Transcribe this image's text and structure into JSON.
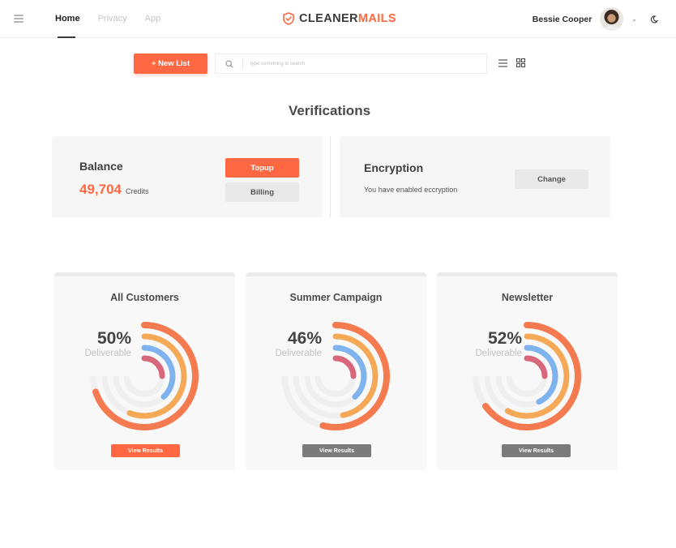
{
  "nav": {
    "items": [
      "Home",
      "Privacy",
      "App"
    ],
    "active": 0
  },
  "brand": {
    "part1": "CLEANER",
    "part2": "MAILS"
  },
  "user": {
    "name": "Bessie Cooper"
  },
  "toolbar": {
    "new_list": "+ New List",
    "search_placeholder": "type something to search"
  },
  "page": {
    "title": "Verifications"
  },
  "balance": {
    "title": "Balance",
    "amount": "49,704",
    "unit": "Credits",
    "topup": "Topup",
    "billing": "Billing"
  },
  "encryption": {
    "title": "Encryption",
    "description": "You have enabled eccryption",
    "change": "Change"
  },
  "cards": [
    {
      "title": "All Customers",
      "percent": "50%",
      "label": "Deliverable",
      "button": "View Results",
      "primary": true,
      "rings": [
        0.7,
        0.56,
        0.38,
        0.25
      ]
    },
    {
      "title": "Summer Campaign",
      "percent": "46%",
      "label": "Deliverable",
      "button": "View Results",
      "primary": false,
      "rings": [
        0.54,
        0.47,
        0.38,
        0.25
      ]
    },
    {
      "title": "Newsletter",
      "percent": "52%",
      "label": "Deliverable",
      "button": "View Results",
      "primary": false,
      "rings": [
        0.65,
        0.58,
        0.43,
        0.25
      ]
    }
  ],
  "colors": {
    "accent": "#ff6842",
    "ring_orange": "#f57a50",
    "ring_amber": "#f5a855",
    "ring_blue": "#7fb3ef",
    "ring_rose": "#d9677c",
    "track": "#efefef",
    "secondary_button": "#7b7b7b"
  },
  "icons": {
    "menu": "hamburger-icon",
    "brand": "shield-icon",
    "search": "search-icon",
    "list_view": "list-view-icon",
    "grid_view": "grid-view-icon",
    "theme": "moon-icon",
    "dropdown": "chevron-down-icon"
  }
}
